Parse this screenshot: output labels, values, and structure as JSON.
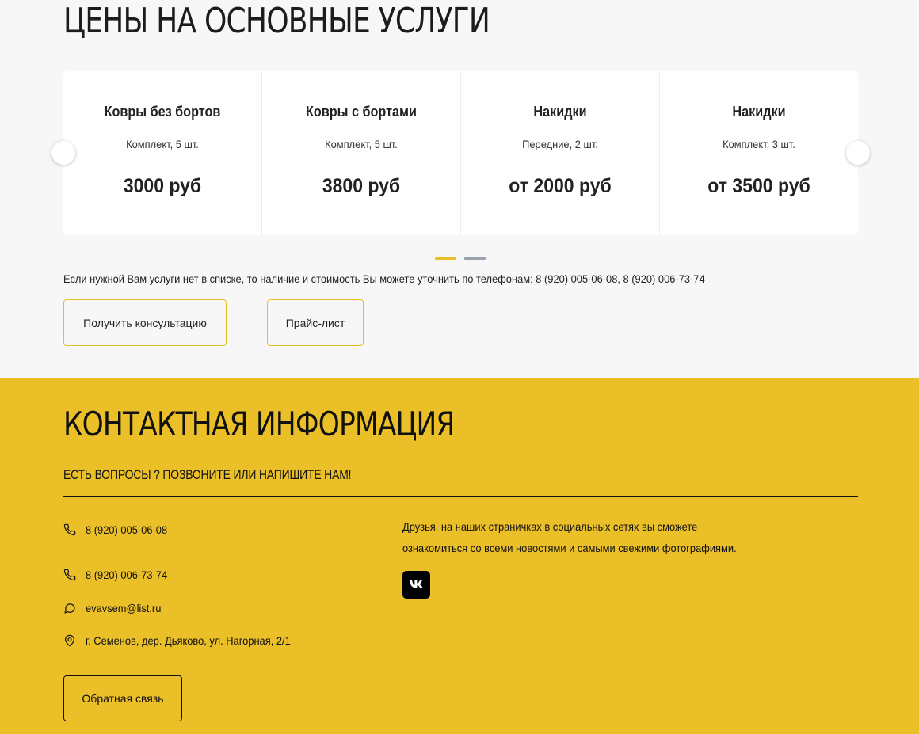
{
  "prices": {
    "title": "ЦЕНЫ НА ОСНОВНЫЕ УСЛУГИ",
    "cards": [
      {
        "name": "Ковры без бортов",
        "desc": "Комплект, 5 шт.",
        "price": "3000 руб"
      },
      {
        "name": "Ковры с бортами",
        "desc": "Комплект, 5 шт.",
        "price": "3800 руб"
      },
      {
        "name": "Накидки",
        "desc": "Передние, 2 шт.",
        "price": "от 2000 руб"
      },
      {
        "name": "Накидки",
        "desc": "Комплект, 3 шт.",
        "price": "от 3500 руб"
      }
    ],
    "note": "Если нужной Вам услуги нет в списке, то наличие и стоимость Вы можете уточнить  по телефонам: 8 (920) 005-06-08, 8 (920) 006-73-74",
    "consult_button": "Получить консультацию",
    "pricelist_button": "Прайс-лист"
  },
  "contacts": {
    "title": "КОНТАКТНАЯ ИНФОРМАЦИЯ",
    "subtitle": "ЕСТЬ ВОПРОСЫ ? ПОЗВОНИТЕ ИЛИ НАПИШИТЕ НАМ!",
    "phone1": "8 (920) 005-06-08",
    "phone2": "8 (920) 006-73-74",
    "email": "evavsem@list.ru",
    "address": "г. Семенов, дер. Дьяково, ул. Нагорная, 2/1",
    "social_line1": "Друзья, на наших страничках в социальных сетях вы сможете",
    "social_line2": "ознакомиться со всеми новостями и самыми свежими фотографиями.",
    "feedback_button": "Обратная связь"
  },
  "colors": {
    "accent": "#ebbf28",
    "background": "#f7f7f7",
    "dot_inactive": "#9aa0ad"
  }
}
